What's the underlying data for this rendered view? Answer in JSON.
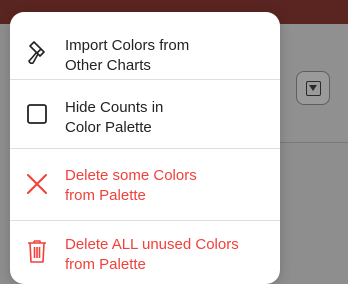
{
  "menu": {
    "items": [
      {
        "label": "Import Colors from\nOther Charts",
        "icon": "paint-brush-icon",
        "color": "#222222"
      },
      {
        "label": "Hide Counts in\nColor Palette",
        "icon": "checkbox-icon",
        "color": "#222222"
      },
      {
        "label": "Delete some Colors\nfrom Palette",
        "icon": "x-mark-icon",
        "color": "#f2403a"
      },
      {
        "label": "Delete ALL unused Colors\nfrom Palette",
        "icon": "trash-icon",
        "color": "#f2403a"
      }
    ]
  },
  "colors": {
    "destructive": "#f2403a",
    "text": "#222222",
    "header_bar": "#5a2521"
  }
}
